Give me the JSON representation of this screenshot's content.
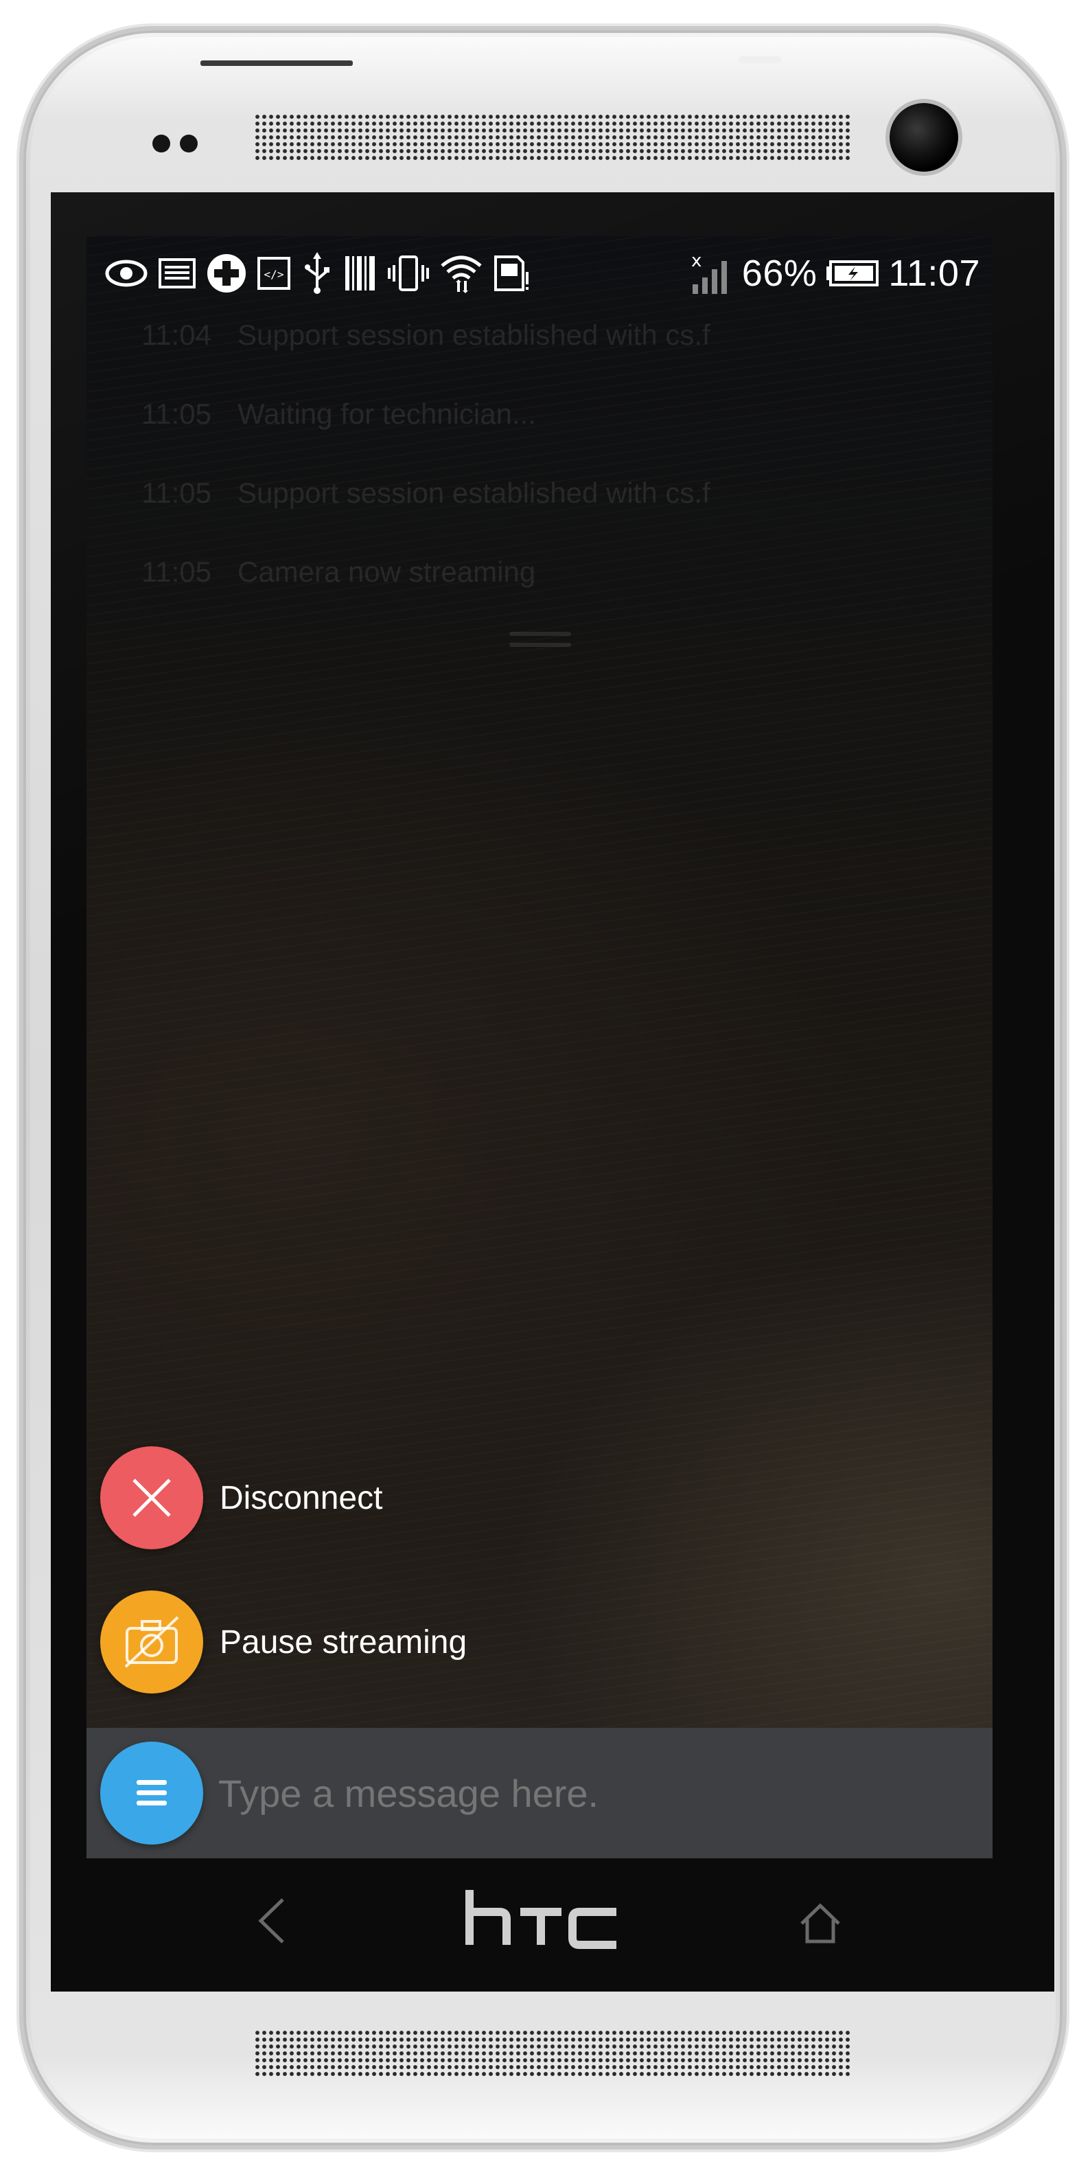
{
  "device": {
    "brand": "htc"
  },
  "status_bar": {
    "icons": [
      "eye-icon",
      "gallery-icon",
      "medical-cross-icon",
      "code-icon",
      "usb-icon",
      "barcode-icon",
      "vibrate-icon",
      "wifi-icon",
      "sim-icon",
      "signal-icon",
      "battery-icon"
    ],
    "battery_percent": "66%",
    "time": "11:07"
  },
  "session_log": [
    {
      "time": "11:04",
      "text": "Support session established with cs.f"
    },
    {
      "time": "11:05",
      "text": "Waiting for technician..."
    },
    {
      "time": "11:05",
      "text": "Support session established with cs.f"
    },
    {
      "time": "11:05",
      "text": "Camera now streaming"
    }
  ],
  "actions": {
    "disconnect_label": "Disconnect",
    "pause_label": "Pause streaming"
  },
  "message": {
    "placeholder": "Type a message here."
  },
  "colors": {
    "disconnect": "#ec5c61",
    "pause": "#f4a623",
    "menu": "#3aa8e8",
    "message_bar": "#3d3f42"
  }
}
